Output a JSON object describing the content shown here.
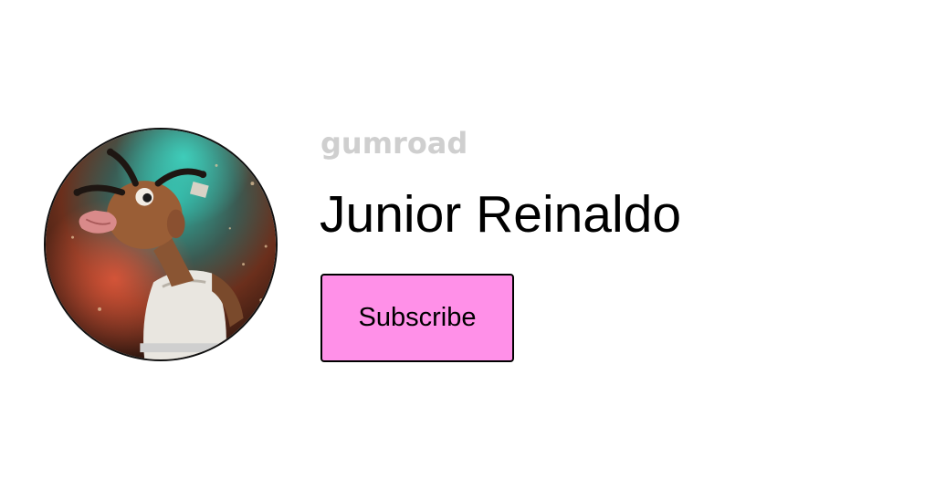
{
  "brand": {
    "logo_text": "GUMROAD"
  },
  "profile": {
    "name": "Junior Reinaldo",
    "avatar": "creator-avatar-illustration"
  },
  "actions": {
    "subscribe_label": "Subscribe"
  },
  "colors": {
    "button_bg": "#ff90e8",
    "logo_gray": "#cfcfcf",
    "text": "#000000",
    "background": "#ffffff"
  }
}
